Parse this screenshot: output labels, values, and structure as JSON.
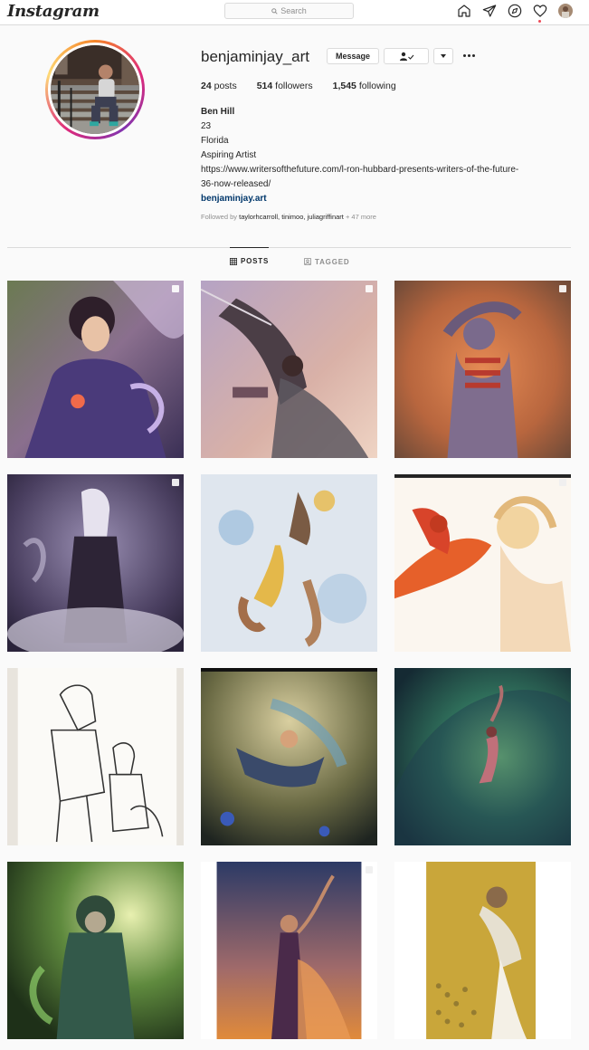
{
  "topbar": {
    "logo": "Instagram",
    "search_placeholder": "Search",
    "icons": [
      "home-icon",
      "direct-icon",
      "explore-icon",
      "activity-heart-icon",
      "profile-avatar-icon"
    ]
  },
  "profile": {
    "username": "benjaminjay_art",
    "message_label": "Message",
    "stats": {
      "posts_count": "24",
      "posts_label": "posts",
      "followers_count": "514",
      "followers_label": "followers",
      "following_count": "1,545",
      "following_label": "following"
    },
    "bio": {
      "name": "Ben Hill",
      "age": "23",
      "location": "Florida",
      "tagline": "Aspiring Artist",
      "url_line1": "https://www.writersofthefuture.com/l-ron-hubbard-presents-writers-of-the-future-",
      "url_line2": "36-now-released/",
      "website": "benjaminjay.art"
    },
    "followed_by_prefix": "Followed by",
    "followed_by_names": "taylorhcarroll, tinimoo, juliagriffinart",
    "followed_by_more": "+ 47 more"
  },
  "tabs": {
    "posts": "POSTS",
    "tagged": "TAGGED"
  },
  "colors": {
    "link": "#00376b",
    "secondary_text": "#8e8e8e",
    "border": "#dbdbdb",
    "notification": "#ed4956"
  },
  "posts": [
    {
      "subject": "sorceress with glowing orb",
      "multi": true
    },
    {
      "subject": "winged warrior diving",
      "multi": true
    },
    {
      "subject": "skeletal figure in flames",
      "multi": true
    },
    {
      "subject": "white-haired mage in fog",
      "multi": true
    },
    {
      "subject": "figures falling through sky",
      "multi": false
    },
    {
      "subject": "woman with phoenix",
      "multi": true
    },
    {
      "subject": "pencil sketch of warriors",
      "multi": false
    },
    {
      "subject": "fairy in forest",
      "multi": false
    },
    {
      "subject": "mermaid in green wave",
      "multi": false
    },
    {
      "subject": "green hooded druid",
      "multi": false
    },
    {
      "subject": "dancer in sunset",
      "multi": true
    },
    {
      "subject": "cat figure on gold art",
      "multi": false
    }
  ]
}
